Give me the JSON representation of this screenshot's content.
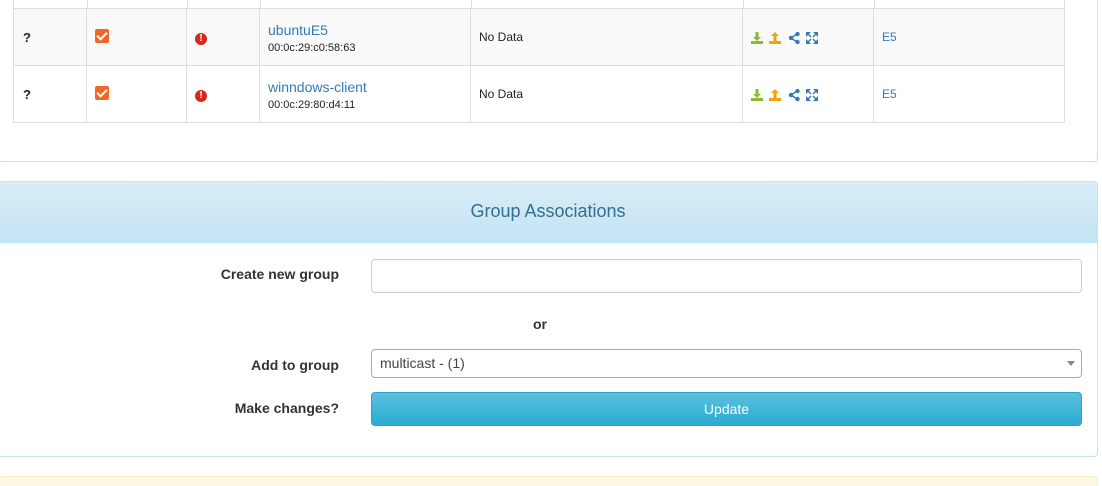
{
  "hosts": [
    {
      "status": "?",
      "name": "ubuntuE5",
      "mac": "00:0c:29:c0:58:63",
      "data": "No Data",
      "image": "E5"
    },
    {
      "status": "?",
      "name": "winndows-client",
      "mac": "00:0c:29:80:d4:11",
      "data": "No Data",
      "image": "E5"
    }
  ],
  "actions": [
    "download-icon",
    "upload-icon",
    "share-icon",
    "expand-icon"
  ],
  "colors": {
    "download": "#8ab933",
    "upload": "#f0a30a",
    "share": "#337ab7",
    "expand": "#337ab7",
    "checkbox": "#f26522",
    "warning": "#d9251c",
    "heading": "#31708f",
    "button": "#5bc0de"
  },
  "group_panel": {
    "title": "Group Associations",
    "create_label": "Create new group",
    "create_value": "",
    "or_text": "or",
    "add_label": "Add to group",
    "add_selected": "multicast - (1)",
    "changes_label": "Make changes?",
    "update_label": "Update"
  }
}
